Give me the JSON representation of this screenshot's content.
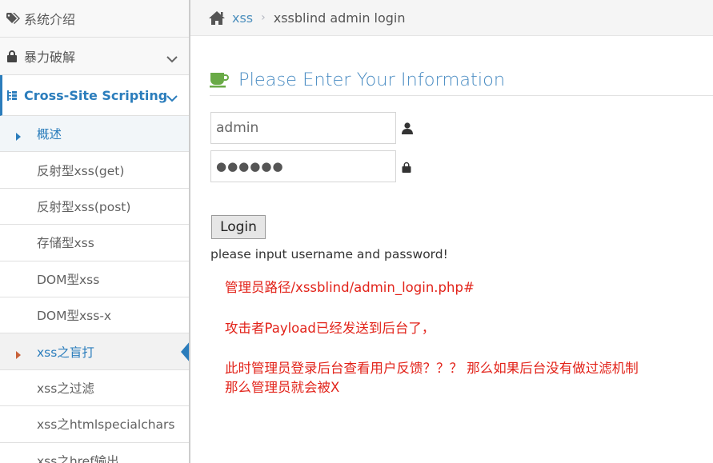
{
  "sidebar": {
    "items": [
      {
        "label": "系统介绍",
        "icon": "tags-icon"
      },
      {
        "label": "暴力破解",
        "icon": "lock-icon"
      },
      {
        "label": "Cross-Site Scripting",
        "icon": "sitemap-icon",
        "expanded": true
      }
    ],
    "xss_subitems": [
      {
        "label": "概述"
      },
      {
        "label": "反射型xss(get)"
      },
      {
        "label": "反射型xss(post)"
      },
      {
        "label": "存储型xss"
      },
      {
        "label": "DOM型xss"
      },
      {
        "label": "DOM型xss-x"
      },
      {
        "label": "xss之盲打",
        "active": true
      },
      {
        "label": "xss之过滤"
      },
      {
        "label": "xss之htmlspecialchars"
      },
      {
        "label": "xss之href输出"
      }
    ]
  },
  "breadcrumb": {
    "home_icon": "home-icon",
    "link": "xss",
    "separator": "›",
    "current": "xssblind admin login"
  },
  "form": {
    "title": "Please Enter Your Information",
    "title_icon": "coffee-icon",
    "username_value": "admin",
    "password_mask": "●●●●●●",
    "login_label": "Login",
    "hint": "please input username and password!"
  },
  "notes": {
    "path": "管理员路径/xssblind/admin_login.php#",
    "payload": "攻击者Payload已经发送到后台了，",
    "question_line1": "此时管理员登录后台查看用户反馈？？？ 那么如果后台没有做过滤机制",
    "question_line2": "那么管理员就会被X"
  },
  "colors": {
    "accent": "#2b7dbc",
    "title": "#4b8dc3",
    "note_red": "#e2231a",
    "coffee_green": "#69aa46"
  }
}
